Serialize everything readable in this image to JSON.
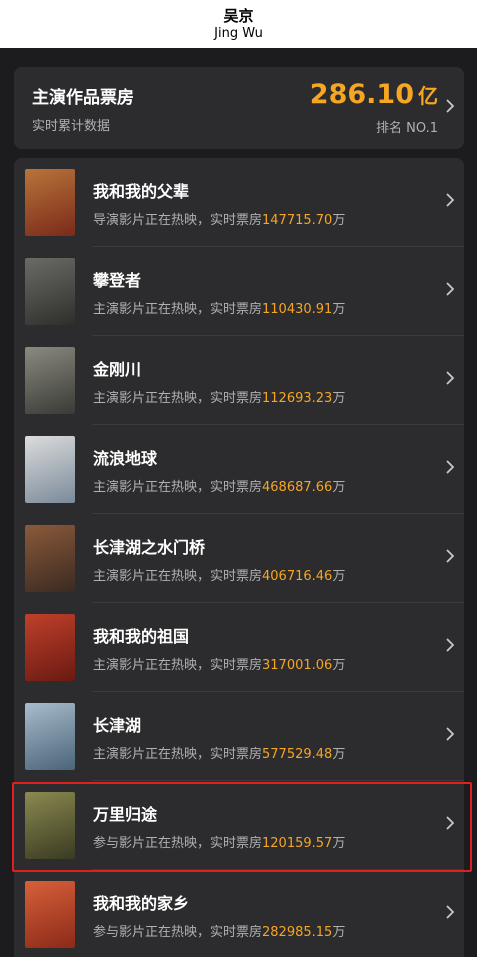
{
  "header": {
    "name_cn": "吴京",
    "name_en": "Jing Wu"
  },
  "summary": {
    "title": "主演作品票房",
    "subtitle": "实时累计数据",
    "amount": "286.10",
    "amount_unit": "亿",
    "rank": "排名 NO.1"
  },
  "films": [
    {
      "title": "我和我的父辈",
      "role": "导演影片正在热映，实时票房",
      "box": "147715.70",
      "unit": "万",
      "poster_colors": [
        "#b8743a",
        "#7a2a1a"
      ]
    },
    {
      "title": "攀登者",
      "role": "主演影片正在热映，实时票房",
      "box": "110430.91",
      "unit": "万",
      "poster_colors": [
        "#6b6b66",
        "#2e2e2c"
      ]
    },
    {
      "title": "金刚川",
      "role": "主演影片正在热映，实时票房",
      "box": "112693.23",
      "unit": "万",
      "poster_colors": [
        "#8a8a80",
        "#3a3a36"
      ]
    },
    {
      "title": "流浪地球",
      "role": "主演影片正在热映，实时票房",
      "box": "468687.66",
      "unit": "万",
      "poster_colors": [
        "#dcdcdc",
        "#7a8a9a"
      ]
    },
    {
      "title": "长津湖之水门桥",
      "role": "主演影片正在热映，实时票房",
      "box": "406716.46",
      "unit": "万",
      "poster_colors": [
        "#8a5a3a",
        "#3a2a22"
      ]
    },
    {
      "title": "我和我的祖国",
      "role": "主演影片正在热映，实时票房",
      "box": "317001.06",
      "unit": "万",
      "poster_colors": [
        "#c0402a",
        "#6a1a12"
      ]
    },
    {
      "title": "长津湖",
      "role": "主演影片正在热映，实时票房",
      "box": "577529.48",
      "unit": "万",
      "poster_colors": [
        "#a8bccc",
        "#4a6478"
      ]
    },
    {
      "title": "万里归途",
      "role": "参与影片正在热映，实时票房",
      "box": "120159.57",
      "unit": "万",
      "poster_colors": [
        "#8a8a50",
        "#3a3a22"
      ]
    },
    {
      "title": "我和我的家乡",
      "role": "参与影片正在热映，实时票房",
      "box": "282985.15",
      "unit": "万",
      "poster_colors": [
        "#d8603a",
        "#8a2a18"
      ]
    }
  ],
  "colors": {
    "accent": "#f5a623",
    "highlight": "#e02020",
    "card": "#2c2c2e",
    "background": "#1c1c1e"
  },
  "icons": {
    "chevron": "chevron-right-icon"
  }
}
